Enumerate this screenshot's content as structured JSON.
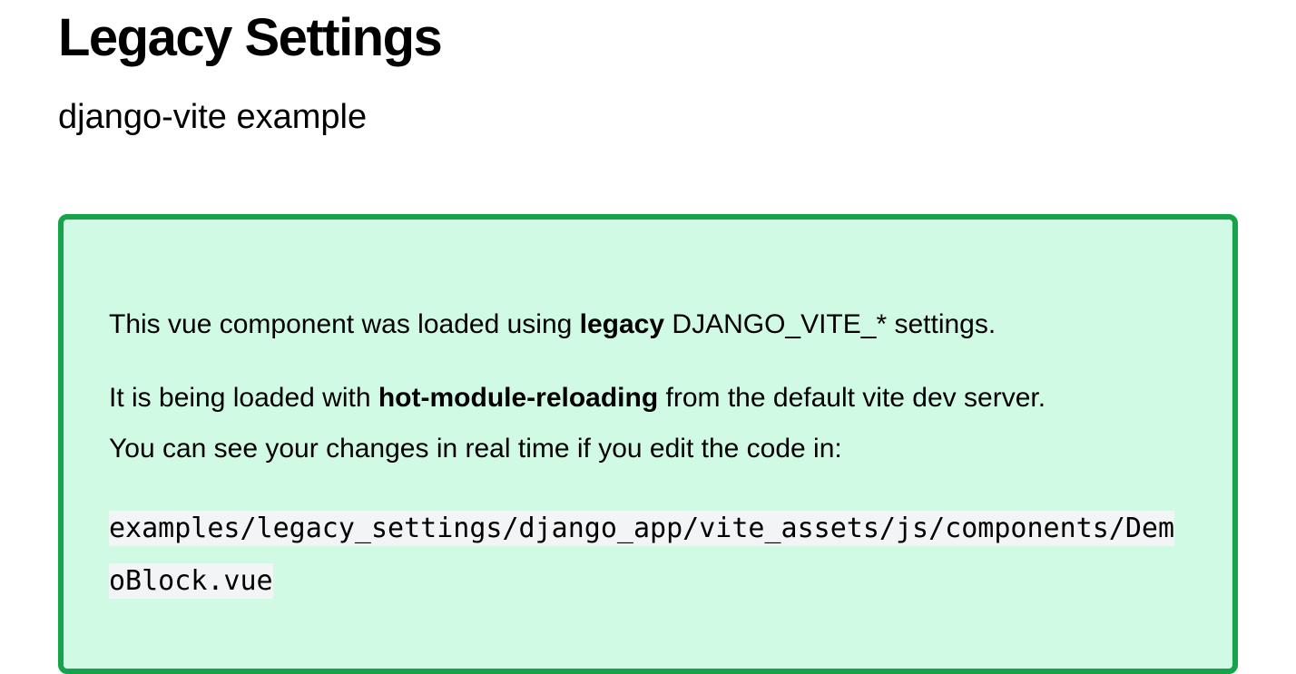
{
  "page": {
    "title": "Legacy Settings",
    "subtitle": "django-vite example"
  },
  "demo_block": {
    "line1_prefix": "This vue component was loaded using ",
    "line1_bold": "legacy",
    "line1_suffix": " DJANGO_VITE_* settings.",
    "line2_prefix": "It is being loaded with ",
    "line2_bold": "hot-module-reloading",
    "line2_suffix": " from the default vite dev server.",
    "line3": "You can see your changes in real time if you edit the code in:",
    "code_path": "examples/legacy_settings/django_app/vite_assets/js/components/DemoBlock.vue"
  },
  "colors": {
    "block_background": "#d1fae5",
    "block_border": "#16a34a",
    "code_background": "#f3f4f6"
  }
}
